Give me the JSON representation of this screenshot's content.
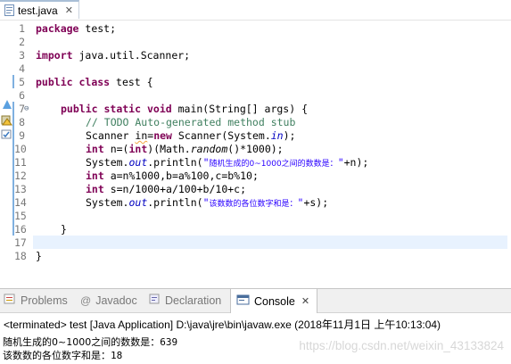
{
  "editor_tab": {
    "label": "test.java",
    "close": "✕"
  },
  "line_numbers": [
    "1",
    "2",
    "3",
    "4",
    "5",
    "6",
    "7",
    "8",
    "9",
    "10",
    "11",
    "12",
    "13",
    "14",
    "15",
    "16",
    "17",
    "18"
  ],
  "code": {
    "l1_kw": "package",
    "l1_rest": " test;",
    "l3_kw": "import",
    "l3_rest": " java.util.Scanner;",
    "l5_kw1": "public",
    "l5_kw2": "class",
    "l5_rest": " test {",
    "l7_kw1": "public",
    "l7_kw2": "static",
    "l7_kw3": "void",
    "l7_rest": " main(String[] args) {",
    "l8_comment": "// TODO Auto-generated method stub",
    "l9_a": "Scanner ",
    "l9_var": "in",
    "l9_b": "=",
    "l9_kw": "new",
    "l9_c": " Scanner(System.",
    "l9_field": "in",
    "l9_d": ");",
    "l10_kw1": "int",
    "l10_a": " n=(",
    "l10_kw2": "int",
    "l10_b": ")(Math.",
    "l10_method": "random",
    "l10_c": "()*1000);",
    "l11_a": "System.",
    "l11_field": "out",
    "l11_b": ".println(",
    "l11_str_open": "\"",
    "l11_str_cjk": "随机生成的0~1000之间的数数是：",
    "l11_str_close": "\"",
    "l11_c": "+n);",
    "l12_kw": "int",
    "l12_rest": " a=n%1000,b=a%100,c=b%10;",
    "l13_kw": "int",
    "l13_rest": " s=n/1000+a/100+b/10+c;",
    "l14_a": "System.",
    "l14_field": "out",
    "l14_b": ".println(",
    "l14_str_open": "\"",
    "l14_str_cjk": "该数数的各位数字和是：",
    "l14_str_close": "\"",
    "l14_c": "+s);",
    "l16": "}",
    "l18": "}"
  },
  "view_tabs": [
    {
      "label": "Problems"
    },
    {
      "label": "Javadoc"
    },
    {
      "label": "Declaration"
    },
    {
      "label": "Console",
      "close": "✕"
    }
  ],
  "console": {
    "status": "<terminated> test [Java Application] D:\\java\\jre\\bin\\javaw.exe (2018年11月1日 上午10:13:04)",
    "out1_label": "随机生成的0~1000之间的数数是：",
    "out1_value": "639",
    "out2_label": "该数数的各位数字和是：",
    "out2_value": "18",
    "watermark": "https://blog.csdn.net/weixin_43133824"
  },
  "colors": {
    "keyword": "#7f0055",
    "comment": "#3f7f5f",
    "string": "#2a00ff",
    "field": "#0000c0"
  }
}
